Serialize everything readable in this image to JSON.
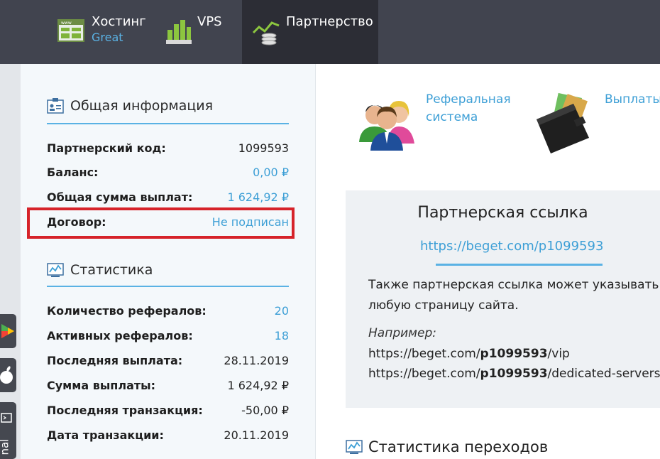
{
  "nav": {
    "hosting": {
      "label": "Хостинг",
      "sublabel": "Great"
    },
    "vps": {
      "label": "VPS"
    },
    "partner": {
      "label": "Партнерство"
    }
  },
  "side": {
    "terminal_fragment": "nal"
  },
  "general": {
    "title": "Общая информация",
    "rows": [
      {
        "key": "Партнерский код:",
        "value": "1099593"
      },
      {
        "key": "Баланс:",
        "value": "0,00 ₽"
      },
      {
        "key": "Общая сумма выплат:",
        "value": "1 624,92 ₽"
      },
      {
        "key": "Договор:",
        "value": "Не подписан"
      }
    ]
  },
  "stats": {
    "title": "Статистика",
    "rows": [
      {
        "key": "Количество рефералов:",
        "value": "20"
      },
      {
        "key": "Активных рефералов:",
        "value": "18"
      },
      {
        "key": "Последняя выплата:",
        "value": "28.11.2019"
      },
      {
        "key": "Сумма выплаты:",
        "value": "1 624,92 ₽"
      },
      {
        "key": "Последняя транзакция:",
        "value": "-50,00 ₽"
      },
      {
        "key": "Дата транзакции:",
        "value": "20.11.2019"
      }
    ]
  },
  "features": {
    "referral": {
      "line1": "Реферальная",
      "line2": "система"
    },
    "payouts": {
      "line1": "Выплаты"
    }
  },
  "link_card": {
    "title": "Партнерская ссылка",
    "url": "https://beget.com/p1099593",
    "desc_line1": "Также партнерская ссылка может указывать на",
    "desc_line2": "любую страницу сайта.",
    "example_label": "Например:",
    "ex1_prefix": "https://beget.com/",
    "ex1_code": "p1099593",
    "ex1_suffix": "/vip",
    "ex2_prefix": "https://beget.com/",
    "ex2_code": "p1099593",
    "ex2_suffix": "/dedicated-servers"
  },
  "transitions": {
    "title": "Статистика переходов"
  },
  "colors": {
    "accent": "#5ab2e4",
    "link": "#3d9fd6",
    "nav_bg": "#41444f",
    "nav_active": "#2c2d35",
    "highlight": "#d6232a"
  }
}
